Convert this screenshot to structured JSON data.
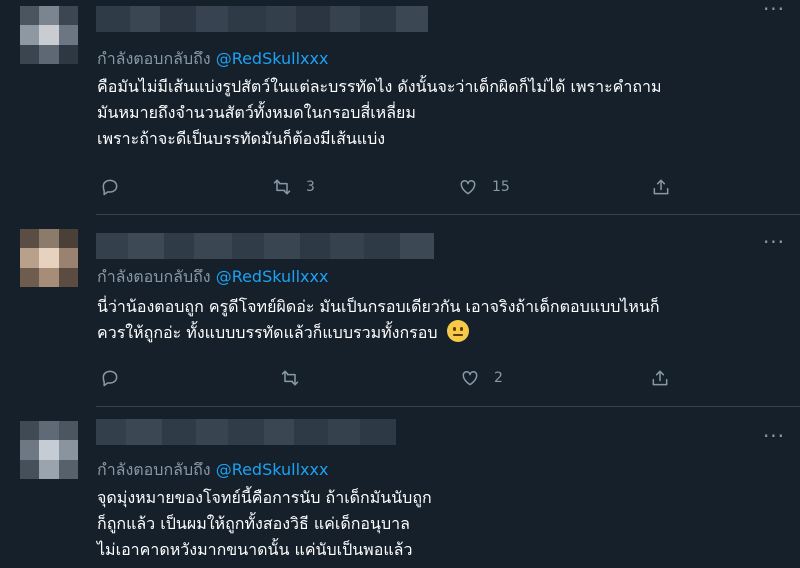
{
  "tweets": [
    {
      "reply_prefix": "กำลังตอบกลับถึง",
      "reply_handle": "@RedSkullxxx",
      "lines": [
        "คือมันไม่มีเส้นแบ่งรูปสัตว์ในแต่ละบรรทัดไง ดังนั้นจะว่าเด็กผิดก็ไม่ได้ เพราะคำถาม",
        "มันหมายถึงจำนวนสัตว์ทั้งหมดในกรอบสี่เหลี่ยม",
        "เพราะถ้าจะดีเป็นบรรทัดมันก็ต้องมีเส้นแบ่ง"
      ],
      "retweets": "3",
      "likes": "15"
    },
    {
      "reply_prefix": "กำลังตอบกลับถึง",
      "reply_handle": "@RedSkullxxx",
      "lines": [
        "นี่ว่าน้องตอบถูก ครูดีโจทย์ผิดอ่ะ มันเป็นกรอบเดียวกัน เอาจริงถ้าเด็กตอบแบบไหนก็",
        "ควรให้ถูกอ่ะ ทั้งแบบบรรทัดแล้วก็แบบรวมทั้งกรอบ"
      ],
      "retweets": "",
      "likes": "2"
    },
    {
      "reply_prefix": "กำลังตอบกลับถึง",
      "reply_handle": "@RedSkullxxx",
      "lines": [
        "จุดมุ่งหมายของโจทย์นี้คือการนับ ถ้าเด็กมันนับถูก",
        "ก็ถูกแล้ว เป็นผมให้ถูกทั้งสองวิธี แค่เด็กอนุบาล",
        "ไม่เอาคาดหวังมากขนาดนั้น แค่นับเป็นพอแล้ว"
      ]
    }
  ],
  "icons": {
    "reply": "reply-icon",
    "retweet": "retweet-icon",
    "like": "heart-icon",
    "share": "share-icon",
    "more": "more-icon",
    "emoji": "confused-face-emoji"
  },
  "colors": {
    "background": "#15202b",
    "handle": "#1da1f2",
    "muted": "#8899a6",
    "divider": "#38444d"
  }
}
